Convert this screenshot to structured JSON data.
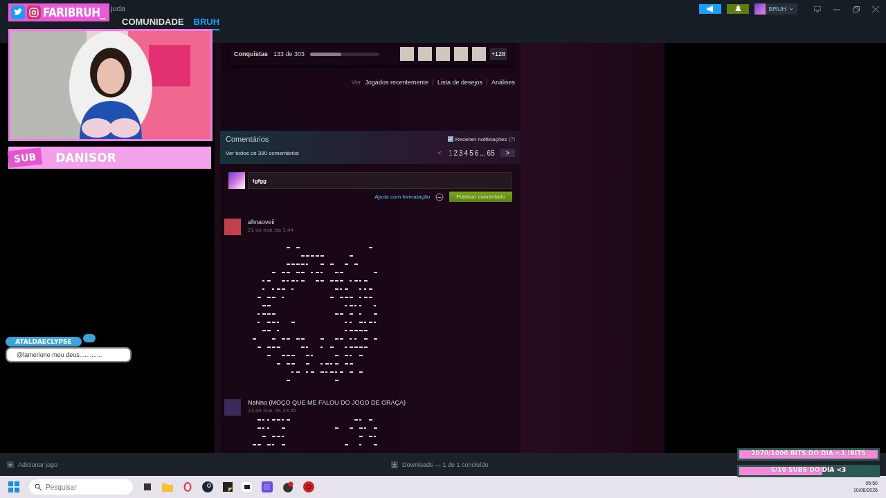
{
  "overlay": {
    "handle": "FARIBRUH_",
    "sub_label": "SUB",
    "subscriber": "DANISOR",
    "chat": {
      "user": "ATALDAECLYPSE",
      "message": "@lamerione meu deus............."
    },
    "goals": [
      {
        "text": "2070/1000 BITS DO DIA <3 !BITS",
        "level": 1
      },
      {
        "text": "6/10 SUBS DO DIA <3",
        "level": 0.6
      }
    ]
  },
  "menu": {
    "items": [
      "juda"
    ]
  },
  "nav": [
    {
      "label": "COMUNIDADE",
      "selected": false
    },
    {
      "label": "BRUH",
      "selected": true
    }
  ],
  "account": {
    "name": "BRUH"
  },
  "achievements": {
    "label": "Conquistas",
    "count": "133 de 303",
    "level": 0.45,
    "more": "+128"
  },
  "view_links": {
    "label": "Ver",
    "links": [
      "Jogados recentemente",
      "Lista de desejos",
      "Análises"
    ]
  },
  "comments": {
    "title": "Comentários",
    "view_all": "Ver todos os 390 comentários",
    "notify": {
      "label": "Receber notificações",
      "checked": true
    },
    "help_mark": "(?)",
    "pager": {
      "prev": "<",
      "next": ">",
      "pages": [
        {
          "label": "1",
          "selected": true
        },
        {
          "label": "2",
          "selected": false
        },
        {
          "label": "3",
          "selected": false
        },
        {
          "label": "4",
          "selected": false
        },
        {
          "label": "5",
          "selected": false
        },
        {
          "label": "6",
          "selected": false
        },
        {
          "label": "...",
          "selected": false
        },
        {
          "label": "65",
          "selected": false
        }
      ]
    },
    "input": {
      "value": "tgfgg"
    },
    "format_help": "Ajuda com formatação",
    "post": "Publicar comentário",
    "items": [
      {
        "author": "ahnaoveii",
        "time": "21 de mai. às 1:44"
      },
      {
        "author": "NaNno (MOÇO QUE ME FALOU DO JOGO DE GRAÇA)",
        "time": "13 de mai. às 23:35"
      }
    ]
  },
  "steam_footer": {
    "add_game": "Adicionar jogo",
    "downloads": "Downloads — 1 de 1 concluído"
  },
  "taskbar": {
    "search_placeholder": "Pesquisar",
    "time": "05:50",
    "date": "10/08/2026"
  }
}
